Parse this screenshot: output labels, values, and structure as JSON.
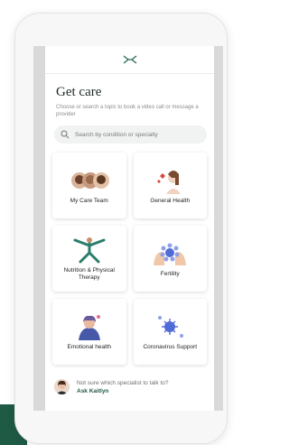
{
  "header": {
    "logo_icon": "care-logo-icon"
  },
  "page": {
    "title": "Get care",
    "subtitle": "Choose or search a topic to book a video call or message a provider"
  },
  "search": {
    "placeholder": "Search by condition or specialty",
    "icon": "search-icon"
  },
  "cards": [
    {
      "label": "My Care Team",
      "icon": "care-team-avatars"
    },
    {
      "label": "General Health",
      "icon": "general-health-illustration"
    },
    {
      "label": "Nutrition & Physical Therapy",
      "icon": "nutrition-illustration"
    },
    {
      "label": "Fertility",
      "icon": "fertility-illustration"
    },
    {
      "label": "Emotional health",
      "icon": "emotional-health-illustration"
    },
    {
      "label": "Coronavirus Support",
      "icon": "coronavirus-illustration"
    }
  ],
  "footer": {
    "question": "Not sure which specialist to talk to?",
    "link": "Ask Kaitlyn"
  },
  "colors": {
    "brand_green": "#1f5a45",
    "card_bg": "#ffffff",
    "search_bg": "#f1f2f2"
  }
}
